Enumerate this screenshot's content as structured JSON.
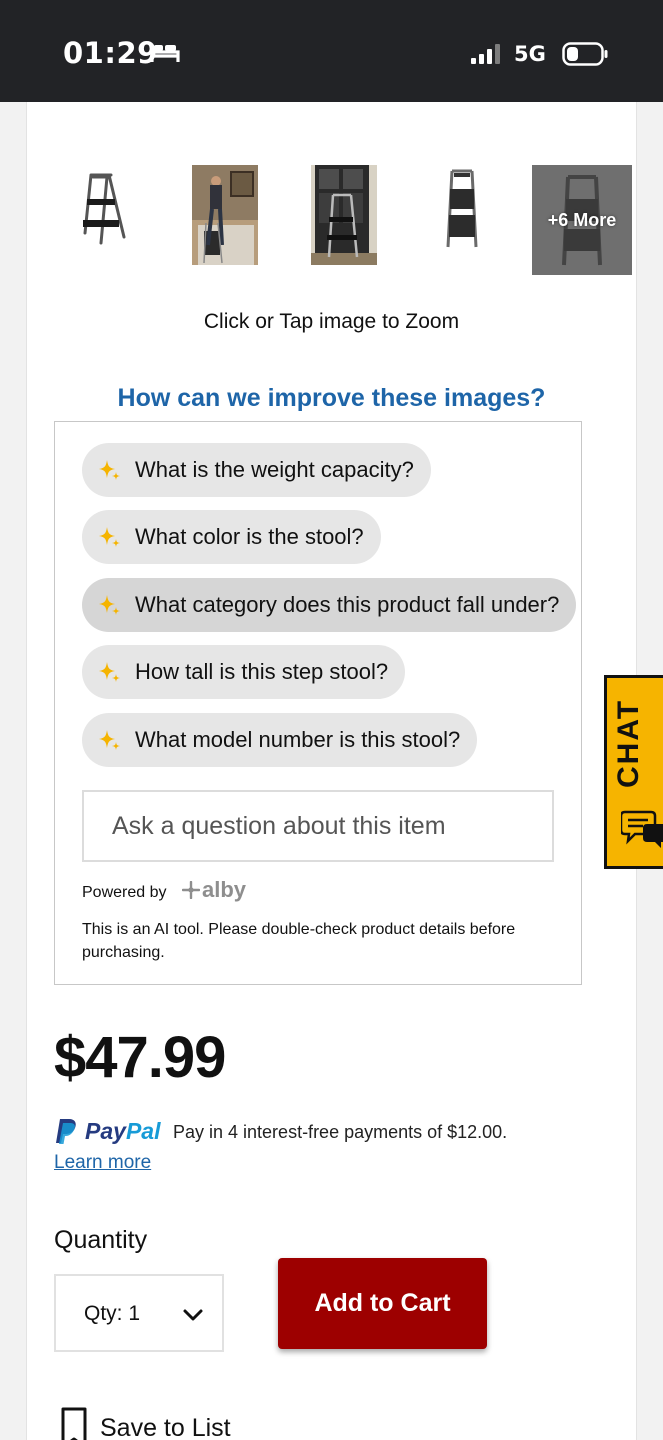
{
  "status_bar": {
    "time": "01:29",
    "network": "5G",
    "icons": [
      "sleep-bed-icon",
      "signal-bars-icon",
      "battery-icon"
    ]
  },
  "gallery": {
    "thumbnails": [
      "step-stool-front",
      "step-stool-in-use",
      "step-stool-doorway",
      "step-stool-side",
      "step-stool-more"
    ],
    "more_label": "+6 More",
    "zoom_hint": "Click or Tap image to Zoom",
    "improve_link": "How can we improve these images?"
  },
  "qa": {
    "suggestions": [
      "What is the weight capacity?",
      "What color is the stool?",
      "What category does this product fall under?",
      "How tall is this step stool?",
      "What model number is this stool?"
    ],
    "input_placeholder": "Ask a question about this item",
    "powered_by": "Powered by",
    "brand": "alby",
    "disclaimer": "This is an AI tool. Please double-check product details before purchasing."
  },
  "pricing": {
    "price": "$47.99",
    "paypal_brand_pay": "Pay",
    "paypal_brand_pal": "Pal",
    "paypal_text": "Pay in 4 interest-free payments of $12.00.",
    "learn_more": "Learn more"
  },
  "purchase": {
    "quantity_label": "Quantity",
    "quantity_value": "Qty: 1",
    "add_to_cart": "Add to Cart",
    "save_to_list": "Save to List"
  },
  "chat": {
    "label": "CHAT"
  },
  "colors": {
    "link_blue": "#1e65a8",
    "add_to_cart_red": "#9d0000",
    "chat_yellow": "#f6b400",
    "sparkle_yellow": "#f5b400",
    "chip_gray": "#e6e6e6"
  }
}
